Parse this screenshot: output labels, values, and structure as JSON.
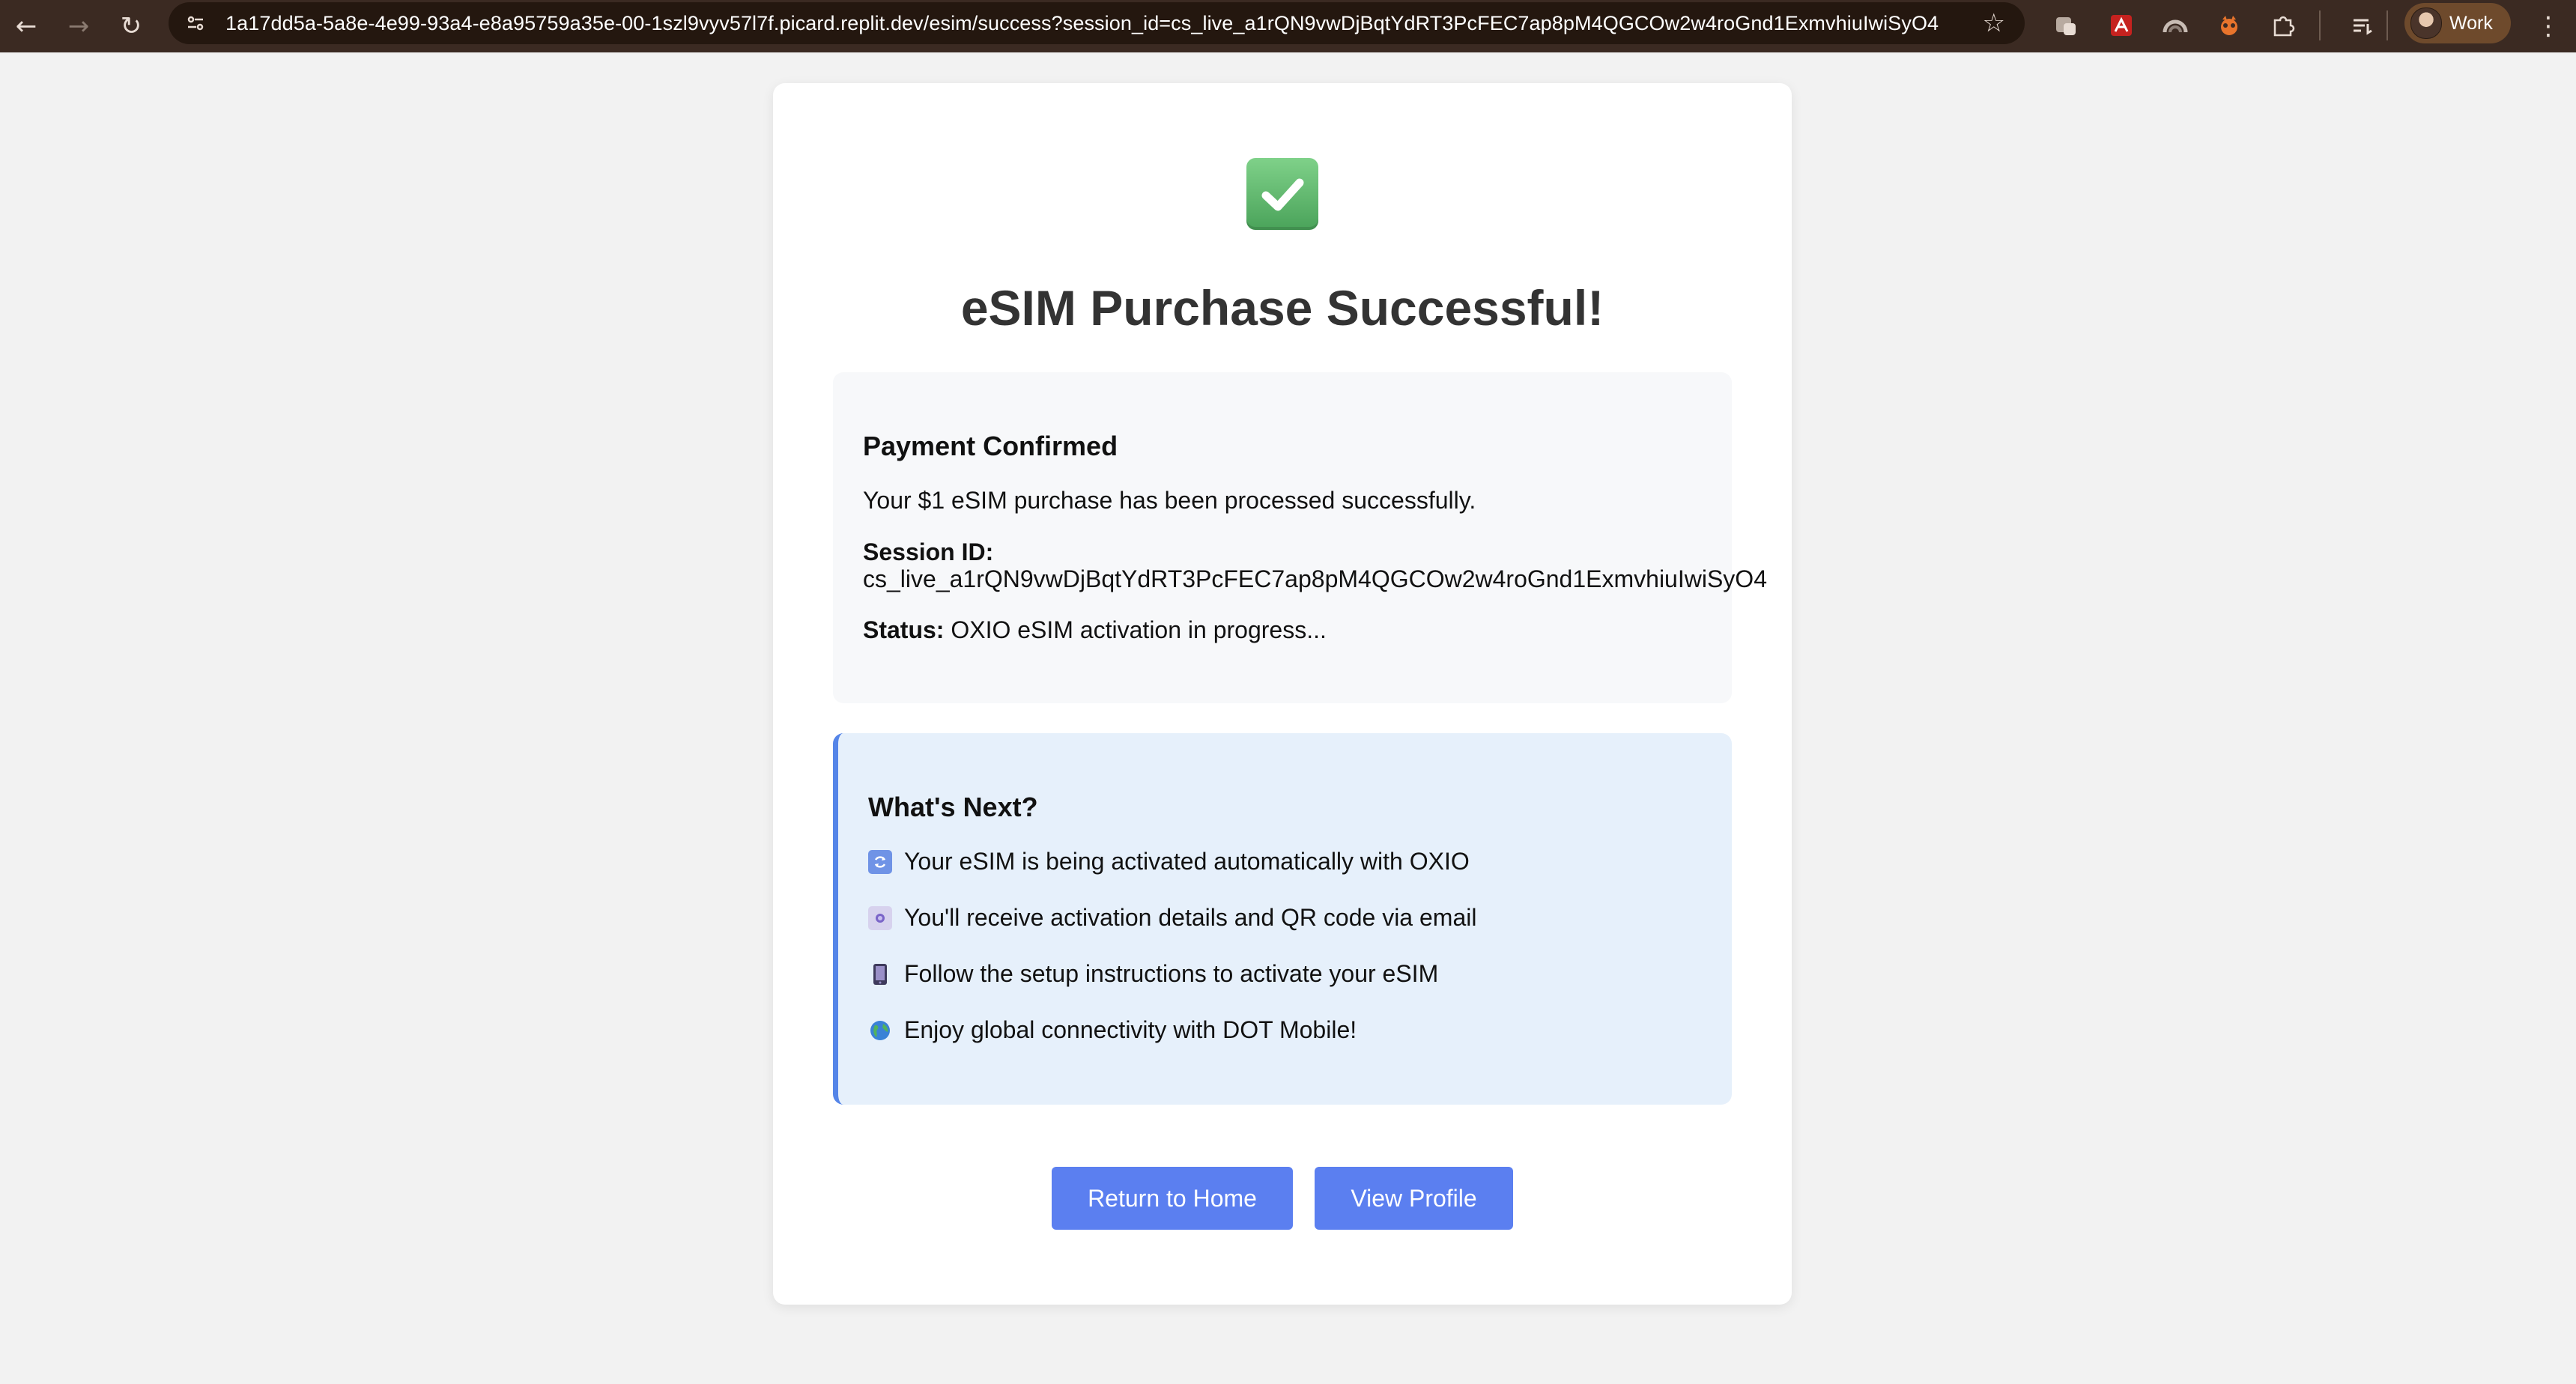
{
  "browser": {
    "url": "1a17dd5a-5a8e-4e99-93a4-e8a95759a35e-00-1szl9vyv57l7f.picard.replit.dev/esim/success?session_id=cs_live_a1rQN9vwDjBqtYdRT3PcFEC7ap8pM4QGCOw2w4roGnd1ExmvhiuIwiSyO4",
    "profile_label": "Work",
    "icons": [
      "back-icon",
      "forward-icon",
      "reload-icon",
      "site-info-icon",
      "bookmark-star-icon",
      "extension-icon",
      "pdf-extension-icon",
      "extension-icon",
      "extension-icon",
      "puzzle-icon",
      "reading-list-icon",
      "menu-icon"
    ]
  },
  "page": {
    "title": "eSIM Purchase Successful!",
    "confirmation": {
      "heading": "Payment Confirmed",
      "message": "Your $1 eSIM purchase has been processed successfully.",
      "session_label": "Session ID:",
      "session_value": "cs_live_a1rQN9vwDjBqtYdRT3PcFEC7ap8pM4QGCOw2w4roGnd1ExmvhiuIwiSyO4",
      "status_label": "Status:",
      "status_value": "OXIO eSIM activation in progress..."
    },
    "next": {
      "heading": "What's Next?",
      "items": [
        {
          "icon": "arrows-cycle-icon",
          "text": "Your eSIM is being activated automatically with OXIO"
        },
        {
          "icon": "email-icon",
          "text": "You'll receive activation details and QR code via email"
        },
        {
          "icon": "phone-icon",
          "text": "Follow the setup instructions to activate your eSIM"
        },
        {
          "icon": "globe-icon",
          "text": "Enjoy global connectivity with DOT Mobile!"
        }
      ]
    },
    "buttons": {
      "home": "Return to Home",
      "profile": "View Profile"
    }
  },
  "colors": {
    "accent": "#5b7ff0",
    "next_border": "#5585e8",
    "next_bg": "#e6f0fb",
    "confirm_bg": "#f7f8fa",
    "success_green": "#4aa35a"
  }
}
